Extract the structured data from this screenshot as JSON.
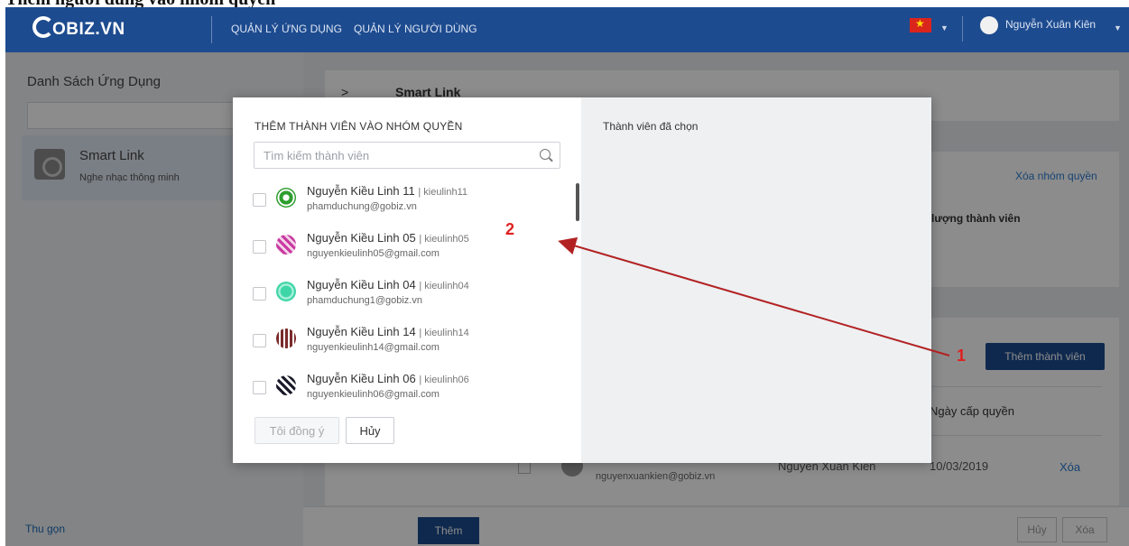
{
  "doc": {
    "cropped_heading": "Thêm người dùng vào nhóm quyền"
  },
  "topbar": {
    "logo": "OBIZ.VN",
    "nav": [
      "QUẢN LÝ ỨNG DỤNG",
      "QUẢN LÝ NGƯỜI DÙNG"
    ],
    "user_name": "Nguyễn Xuân Kiên"
  },
  "sidebar": {
    "title": "Danh Sách Ứng Dụng",
    "app": {
      "name": "Smart Link",
      "description": "Nghe nhạc thông minh"
    },
    "collapse_label": "Thu gọn"
  },
  "main": {
    "breadcrumb_sep": ">",
    "app_name": "Smart Link",
    "delete_group": "Xóa nhóm quyền",
    "member_count_label": "lượng thành viên",
    "add_member_button": "Thêm thành viên",
    "table": {
      "date_header": "Ngày cấp quyền",
      "row": {
        "email": "nguyenxuankien@gobiz.vn",
        "granter": "Nguyen Xuan Kien",
        "date": "10/03/2019",
        "delete": "Xóa"
      }
    },
    "footer": {
      "add": "Thêm",
      "cancel": "Hủy",
      "delete": "Xóa"
    }
  },
  "modal": {
    "title": "THÊM THÀNH VIÊN VÀO NHÓM QUYỀN",
    "selected_title": "Thành viên đã chọn",
    "search_placeholder": "Tìm kiếm thành viên",
    "members": [
      {
        "name": "Nguyễn Kiều Linh 11",
        "username": "kieulinh11",
        "email": "phamduchung@gobiz.vn",
        "color": "#2e9e2e"
      },
      {
        "name": "Nguyễn Kiều Linh 05",
        "username": "kieulinh05",
        "email": "nguyenkieulinh05@gmail.com",
        "color": "#c83aa0"
      },
      {
        "name": "Nguyễn Kiều Linh 04",
        "username": "kieulinh04",
        "email": "phamduchung1@gobiz.vn",
        "color": "#3fd6a6"
      },
      {
        "name": "Nguyễn Kiều Linh 14",
        "username": "kieulinh14",
        "email": "nguyenkieulinh14@gmail.com",
        "color": "#7a2a2a"
      },
      {
        "name": "Nguyễn Kiều Linh 06",
        "username": "kieulinh06",
        "email": "nguyenkieulinh06@gmail.com",
        "color": "#1a1a2a"
      }
    ],
    "agree_button": "Tôi đồng ý",
    "cancel_button": "Hủy"
  },
  "annotations": {
    "step1": "1",
    "step2": "2",
    "color": "#e02020"
  }
}
